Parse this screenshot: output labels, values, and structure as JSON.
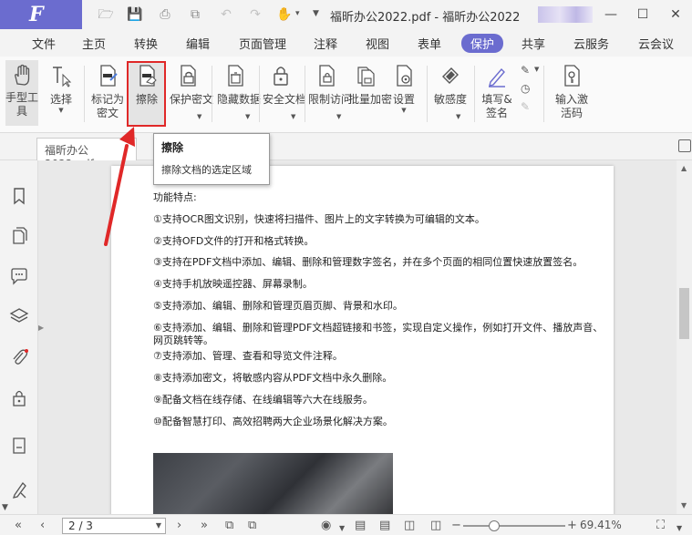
{
  "title_bar": {
    "document_title": "福昕办公2022.pdf - 福昕办公2022",
    "logo_letter": "F"
  },
  "menu": {
    "items": [
      "文件",
      "主页",
      "转换",
      "编辑",
      "页面管理",
      "注释",
      "视图",
      "表单",
      "保护",
      "共享",
      "云服务",
      "云会议"
    ],
    "active": "保护"
  },
  "ribbon": {
    "hand_tool": "手型工具",
    "select": "选择",
    "mark_redact": "标记为密文",
    "erase": "擦除",
    "protect_redact": "保护密文",
    "hide_data": "隐藏数据",
    "secure_doc": "安全文档",
    "restrict_access": "限制访问",
    "batch_encrypt": "批量加密",
    "settings": "设置",
    "sensitivity": "敏感度",
    "fill_sign": "填写&签名",
    "enter_code": "输入激活码"
  },
  "tab": {
    "label": "福昕办公2022.pdf"
  },
  "tooltip": {
    "title": "擦除",
    "description": "擦除文档的选定区域"
  },
  "page_content": {
    "heading": "功能特点:",
    "lines": [
      "①支持OCR图文识别，快速将扫描件、图片上的文字转换为可编辑的文本。",
      "②支持OFD文件的打开和格式转换。",
      "③支持在PDF文档中添加、编辑、删除和管理数字签名，并在多个页面的相同位置快速放置签名。",
      "④支持手机放映遥控器、屏幕录制。",
      "⑤支持添加、编辑、删除和管理页眉页脚、背景和水印。",
      "⑥支持添加、编辑、删除和管理PDF文档超链接和书签，实现自定义操作，例如打开文件、播放声音、网页跳转等。",
      "⑦支持添加、管理、查看和导览文件注释。",
      "⑧支持添加密文，将敏感内容从PDF文档中永久删除。",
      "⑨配备文档在线存储、在线编辑等六大在线服务。",
      "⑩配备智慧打印、高效招聘两大企业场景化解决方案。"
    ]
  },
  "status_bar": {
    "page_value": "2 / 3",
    "zoom": "69.41%",
    "zoom_fraction": 0.3
  },
  "colors": {
    "accent": "#6b6ccf",
    "highlight": "#e02828"
  }
}
